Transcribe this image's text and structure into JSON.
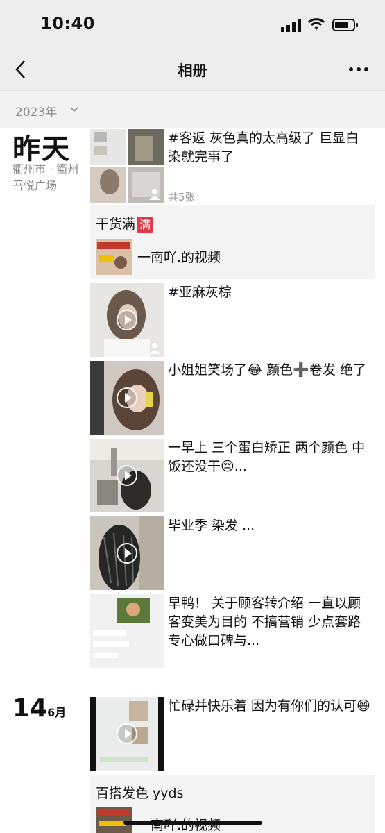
{
  "status": {
    "time": "10:40"
  },
  "nav": {
    "title": "相册"
  },
  "year_filter": {
    "label": "2023年"
  },
  "groups": [
    {
      "date_big": "昨天",
      "location": "衢州市 · 衢州吾悦广场"
    },
    {
      "day": "14",
      "month": "6月"
    }
  ],
  "posts": [
    {
      "caption": "#客返  灰色真的太高级了  巨显白  染就完事了",
      "count": "共5张"
    },
    {
      "share_title": "干货满",
      "badge": "满",
      "share_text": "一南吖.的视频"
    },
    {
      "caption": "#亚麻灰棕"
    },
    {
      "caption": "小姐姐笑场了😂  颜色➕卷发 绝了"
    },
    {
      "caption": "一早上 三个蛋白矫正 两个颜色  中饭还没干😔..."
    },
    {
      "caption": "毕业季   染发   ..."
    },
    {
      "caption": "早鸭！  关于顾客转介绍   一直以顾客变美为目的    不搞营销  少点套路  专心做口碑与..."
    },
    {
      "caption": "忙碌并快乐着    因为有你们的认可😄"
    },
    {
      "share_title": "百搭发色  yyds",
      "share_text": "一南吖.的视频"
    }
  ],
  "icons": {
    "back": "chevron-left-icon",
    "more": "more-dots-icon",
    "year_dropdown": "chevron-down-icon",
    "play": "play-icon",
    "person": "person-icon"
  }
}
